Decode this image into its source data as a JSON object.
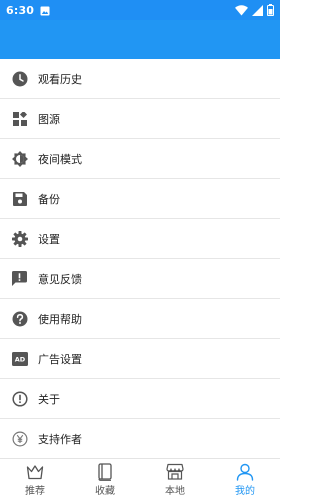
{
  "status_bar": {
    "time": "6:30"
  },
  "menu": {
    "items": [
      {
        "label": "观看历史",
        "icon": "history-clock-icon"
      },
      {
        "label": "图源",
        "icon": "widgets-icon"
      },
      {
        "label": "夜间模式",
        "icon": "brightness-icon"
      },
      {
        "label": "备份",
        "icon": "save-icon"
      },
      {
        "label": "设置",
        "icon": "gear-icon"
      },
      {
        "label": "意见反馈",
        "icon": "feedback-icon"
      },
      {
        "label": "使用帮助",
        "icon": "help-icon"
      },
      {
        "label": "广告设置",
        "icon": "ad-icon"
      },
      {
        "label": "关于",
        "icon": "info-icon"
      },
      {
        "label": "支持作者",
        "icon": "yen-icon"
      }
    ]
  },
  "bottom_nav": {
    "items": [
      {
        "label": "推荐",
        "icon": "crown-icon",
        "active": false
      },
      {
        "label": "收藏",
        "icon": "book-icon",
        "active": false
      },
      {
        "label": "本地",
        "icon": "store-icon",
        "active": false
      },
      {
        "label": "我的",
        "icon": "person-icon",
        "active": true
      }
    ]
  },
  "colors": {
    "primary": "#2196f3",
    "status_bar": "#1f8ff4",
    "icon": "#555555",
    "divider": "#e6e6e6"
  }
}
